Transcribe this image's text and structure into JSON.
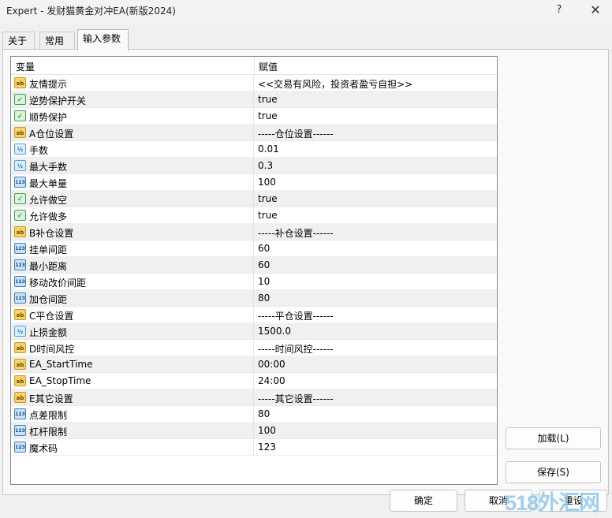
{
  "window": {
    "title": "Expert - 发财猫黄金对冲EA(新版2024)",
    "help_label": "?",
    "close_label": "✕"
  },
  "tabs": [
    {
      "label": "关于"
    },
    {
      "label": "常用"
    },
    {
      "label": "输入参数"
    }
  ],
  "grid": {
    "col_variable": "变量",
    "col_value": "赋值",
    "rows": [
      {
        "icon": "string-icon",
        "type": "ab",
        "name": "友情提示",
        "value": "<<交易有风险，投资者盈亏自担>>"
      },
      {
        "icon": "bool-icon",
        "type": "bool",
        "name": "逆势保护开关",
        "value": "true"
      },
      {
        "icon": "bool-icon",
        "type": "bool",
        "name": "顺势保护",
        "value": "true"
      },
      {
        "icon": "string-icon",
        "type": "ab",
        "name": "A仓位设置",
        "value": "-----仓位设置------"
      },
      {
        "icon": "double-icon",
        "type": "half",
        "name": "手数",
        "value": "0.01"
      },
      {
        "icon": "double-icon",
        "type": "half",
        "name": "最大手数",
        "value": "0.3"
      },
      {
        "icon": "int-icon",
        "type": "n123",
        "name": "最大单量",
        "value": "100"
      },
      {
        "icon": "bool-icon",
        "type": "bool",
        "name": "允许做空",
        "value": "true"
      },
      {
        "icon": "bool-icon",
        "type": "bool",
        "name": "允许做多",
        "value": "true"
      },
      {
        "icon": "string-icon",
        "type": "ab",
        "name": "B补仓设置",
        "value": "-----补仓设置------"
      },
      {
        "icon": "int-icon",
        "type": "n123",
        "name": "挂单间距",
        "value": "60"
      },
      {
        "icon": "int-icon",
        "type": "n123",
        "name": "最小距离",
        "value": "60"
      },
      {
        "icon": "int-icon",
        "type": "n123",
        "name": "移动改价间距",
        "value": "10"
      },
      {
        "icon": "int-icon",
        "type": "n123",
        "name": "加仓间距",
        "value": "80"
      },
      {
        "icon": "string-icon",
        "type": "ab",
        "name": "C平仓设置",
        "value": "-----平仓设置------"
      },
      {
        "icon": "double-icon",
        "type": "half",
        "name": "止损金额",
        "value": "1500.0"
      },
      {
        "icon": "string-icon",
        "type": "ab",
        "name": "D时间风控",
        "value": "-----时间风控------"
      },
      {
        "icon": "string-icon",
        "type": "ab",
        "name": "EA_StartTime",
        "value": "00:00"
      },
      {
        "icon": "string-icon",
        "type": "ab",
        "name": "EA_StopTime",
        "value": "24:00"
      },
      {
        "icon": "string-icon",
        "type": "ab",
        "name": "E其它设置",
        "value": "-----其它设置------"
      },
      {
        "icon": "int-icon",
        "type": "n123",
        "name": "点差限制",
        "value": "80"
      },
      {
        "icon": "int-icon",
        "type": "n123",
        "name": "杠杆限制",
        "value": "100"
      },
      {
        "icon": "int-icon",
        "type": "n123",
        "name": "魔术码",
        "value": "123"
      }
    ]
  },
  "icon_glyphs": {
    "ab": "ab",
    "bool": "✓",
    "half": "½",
    "n123": "123"
  },
  "buttons": {
    "load": "加载(L)",
    "save": "保存(S)",
    "ok": "确定",
    "cancel": "取消",
    "reset": "重设"
  },
  "watermark": "518外汇网"
}
